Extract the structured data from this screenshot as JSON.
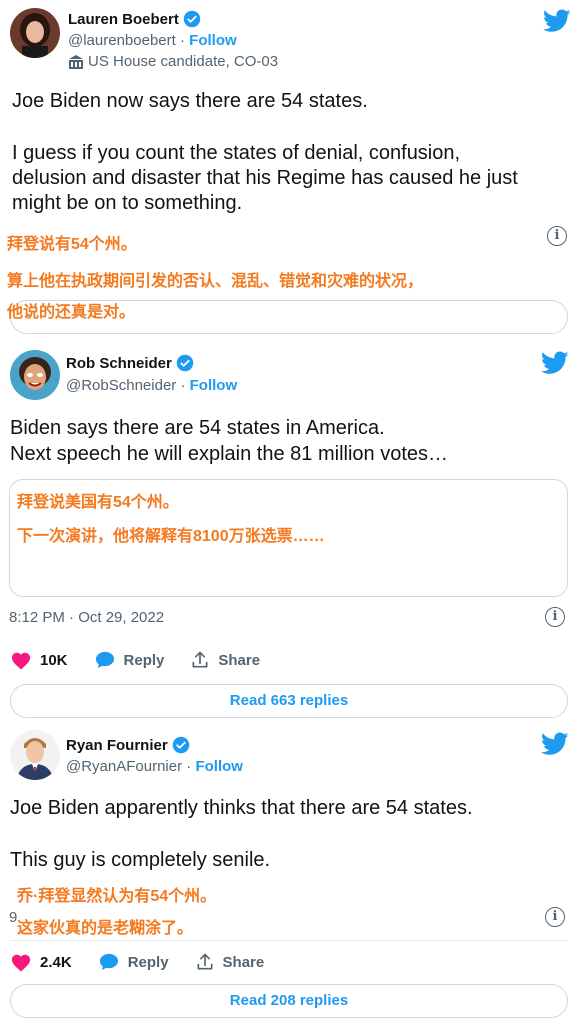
{
  "tweets": [
    {
      "name": "Lauren Boebert",
      "handle": "@laurenboebert",
      "separator": "·",
      "follow": "Follow",
      "label": "US House candidate, CO-03",
      "body_lines": [
        "Joe Biden now says there are 54 states.",
        "",
        "I guess if you count the states of denial, confusion,",
        "delusion and disaster that his Regime has caused he just",
        "might be on to something."
      ],
      "translation_lines": [
        "拜登说有54个州。",
        "算上他在执政期间引发的否认、混乱、错觉和灾难的状况，",
        "他说的还真是对。"
      ]
    },
    {
      "name": "Rob Schneider",
      "handle": "@RobSchneider",
      "separator": "·",
      "follow": "Follow",
      "body_lines": [
        "Biden says there are 54 states in America.",
        "Next speech he will explain the 81 million votes…"
      ],
      "translation_lines": [
        "拜登说美国有54个州。",
        "下一次演讲，他将解释有8100万张选票……"
      ],
      "timestamp": "8:12 PM · Oct 29, 2022",
      "likes": "10K",
      "reply_label": "Reply",
      "share_label": "Share",
      "read_replies": "Read 663 replies"
    },
    {
      "name": "Ryan Fournier",
      "handle": "@RyanAFournier",
      "separator": "·",
      "follow": "Follow",
      "body_lines": [
        "Joe Biden apparently thinks that there are 54 states.",
        "",
        "This guy is completely senile."
      ],
      "translation_lines": [
        "乔·拜登显然认为有54个州。",
        "这家伙真的是老糊涂了。"
      ],
      "timestamp_partial": "9",
      "likes": "2.4K",
      "reply_label": "Reply",
      "share_label": "Share",
      "read_replies": "Read 208 replies"
    }
  ],
  "icons": [
    "verified-badge-icon",
    "twitter-bird-icon",
    "info-icon",
    "heart-icon",
    "reply-bubble-icon",
    "share-icon",
    "government-building-icon"
  ],
  "colors": {
    "twitter_blue": "#1d9bf0",
    "translation_orange": "#f47a20",
    "heart_pink": "#f91880",
    "secondary_text": "#536471"
  }
}
